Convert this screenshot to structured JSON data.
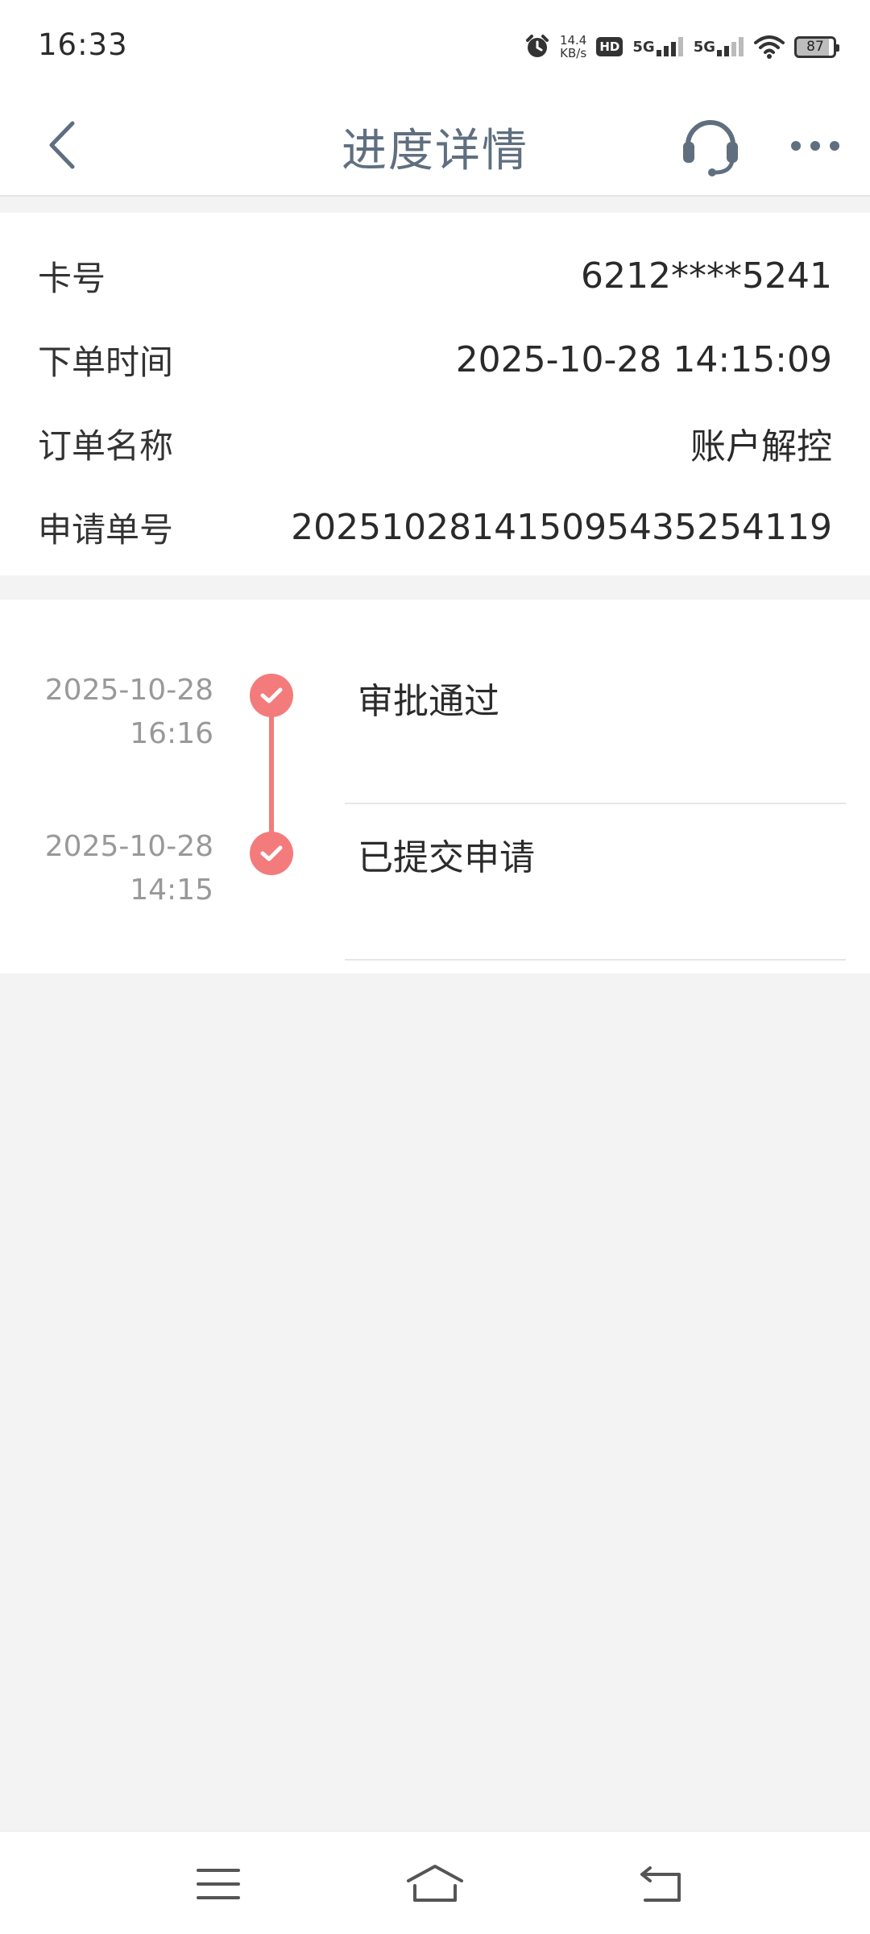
{
  "status_bar": {
    "time": "16:33",
    "network_speed_value": "14.4",
    "network_speed_unit": "KB/s",
    "hd_label": "HD",
    "sim1_label": "5G",
    "sim2_label": "5G",
    "battery_level": "87",
    "icons": [
      "alarm-icon",
      "hd-icon",
      "signal-icon",
      "wifi-icon",
      "battery-icon"
    ]
  },
  "navbar": {
    "title": "进度详情",
    "back_icon": "chevron-left-icon",
    "service_icon": "headset-icon",
    "more_icon": "more-dots-icon"
  },
  "order_info": [
    {
      "label": "卡号",
      "value": "6212****5241"
    },
    {
      "label": "下单时间",
      "value": "2025-10-28 14:15:09"
    },
    {
      "label": "订单名称",
      "value": "账户解控"
    },
    {
      "label": "申请单号",
      "value": "2025102814150954352541​19"
    }
  ],
  "timeline": [
    {
      "date": "2025-10-28",
      "time": "16:16",
      "status": "审批通过"
    },
    {
      "date": "2025-10-28",
      "time": "14:15",
      "status": "已提交申请"
    }
  ],
  "colors": {
    "accent": "#f47b7b",
    "title": "#5f6f7f",
    "background": "#f3f3f3"
  }
}
